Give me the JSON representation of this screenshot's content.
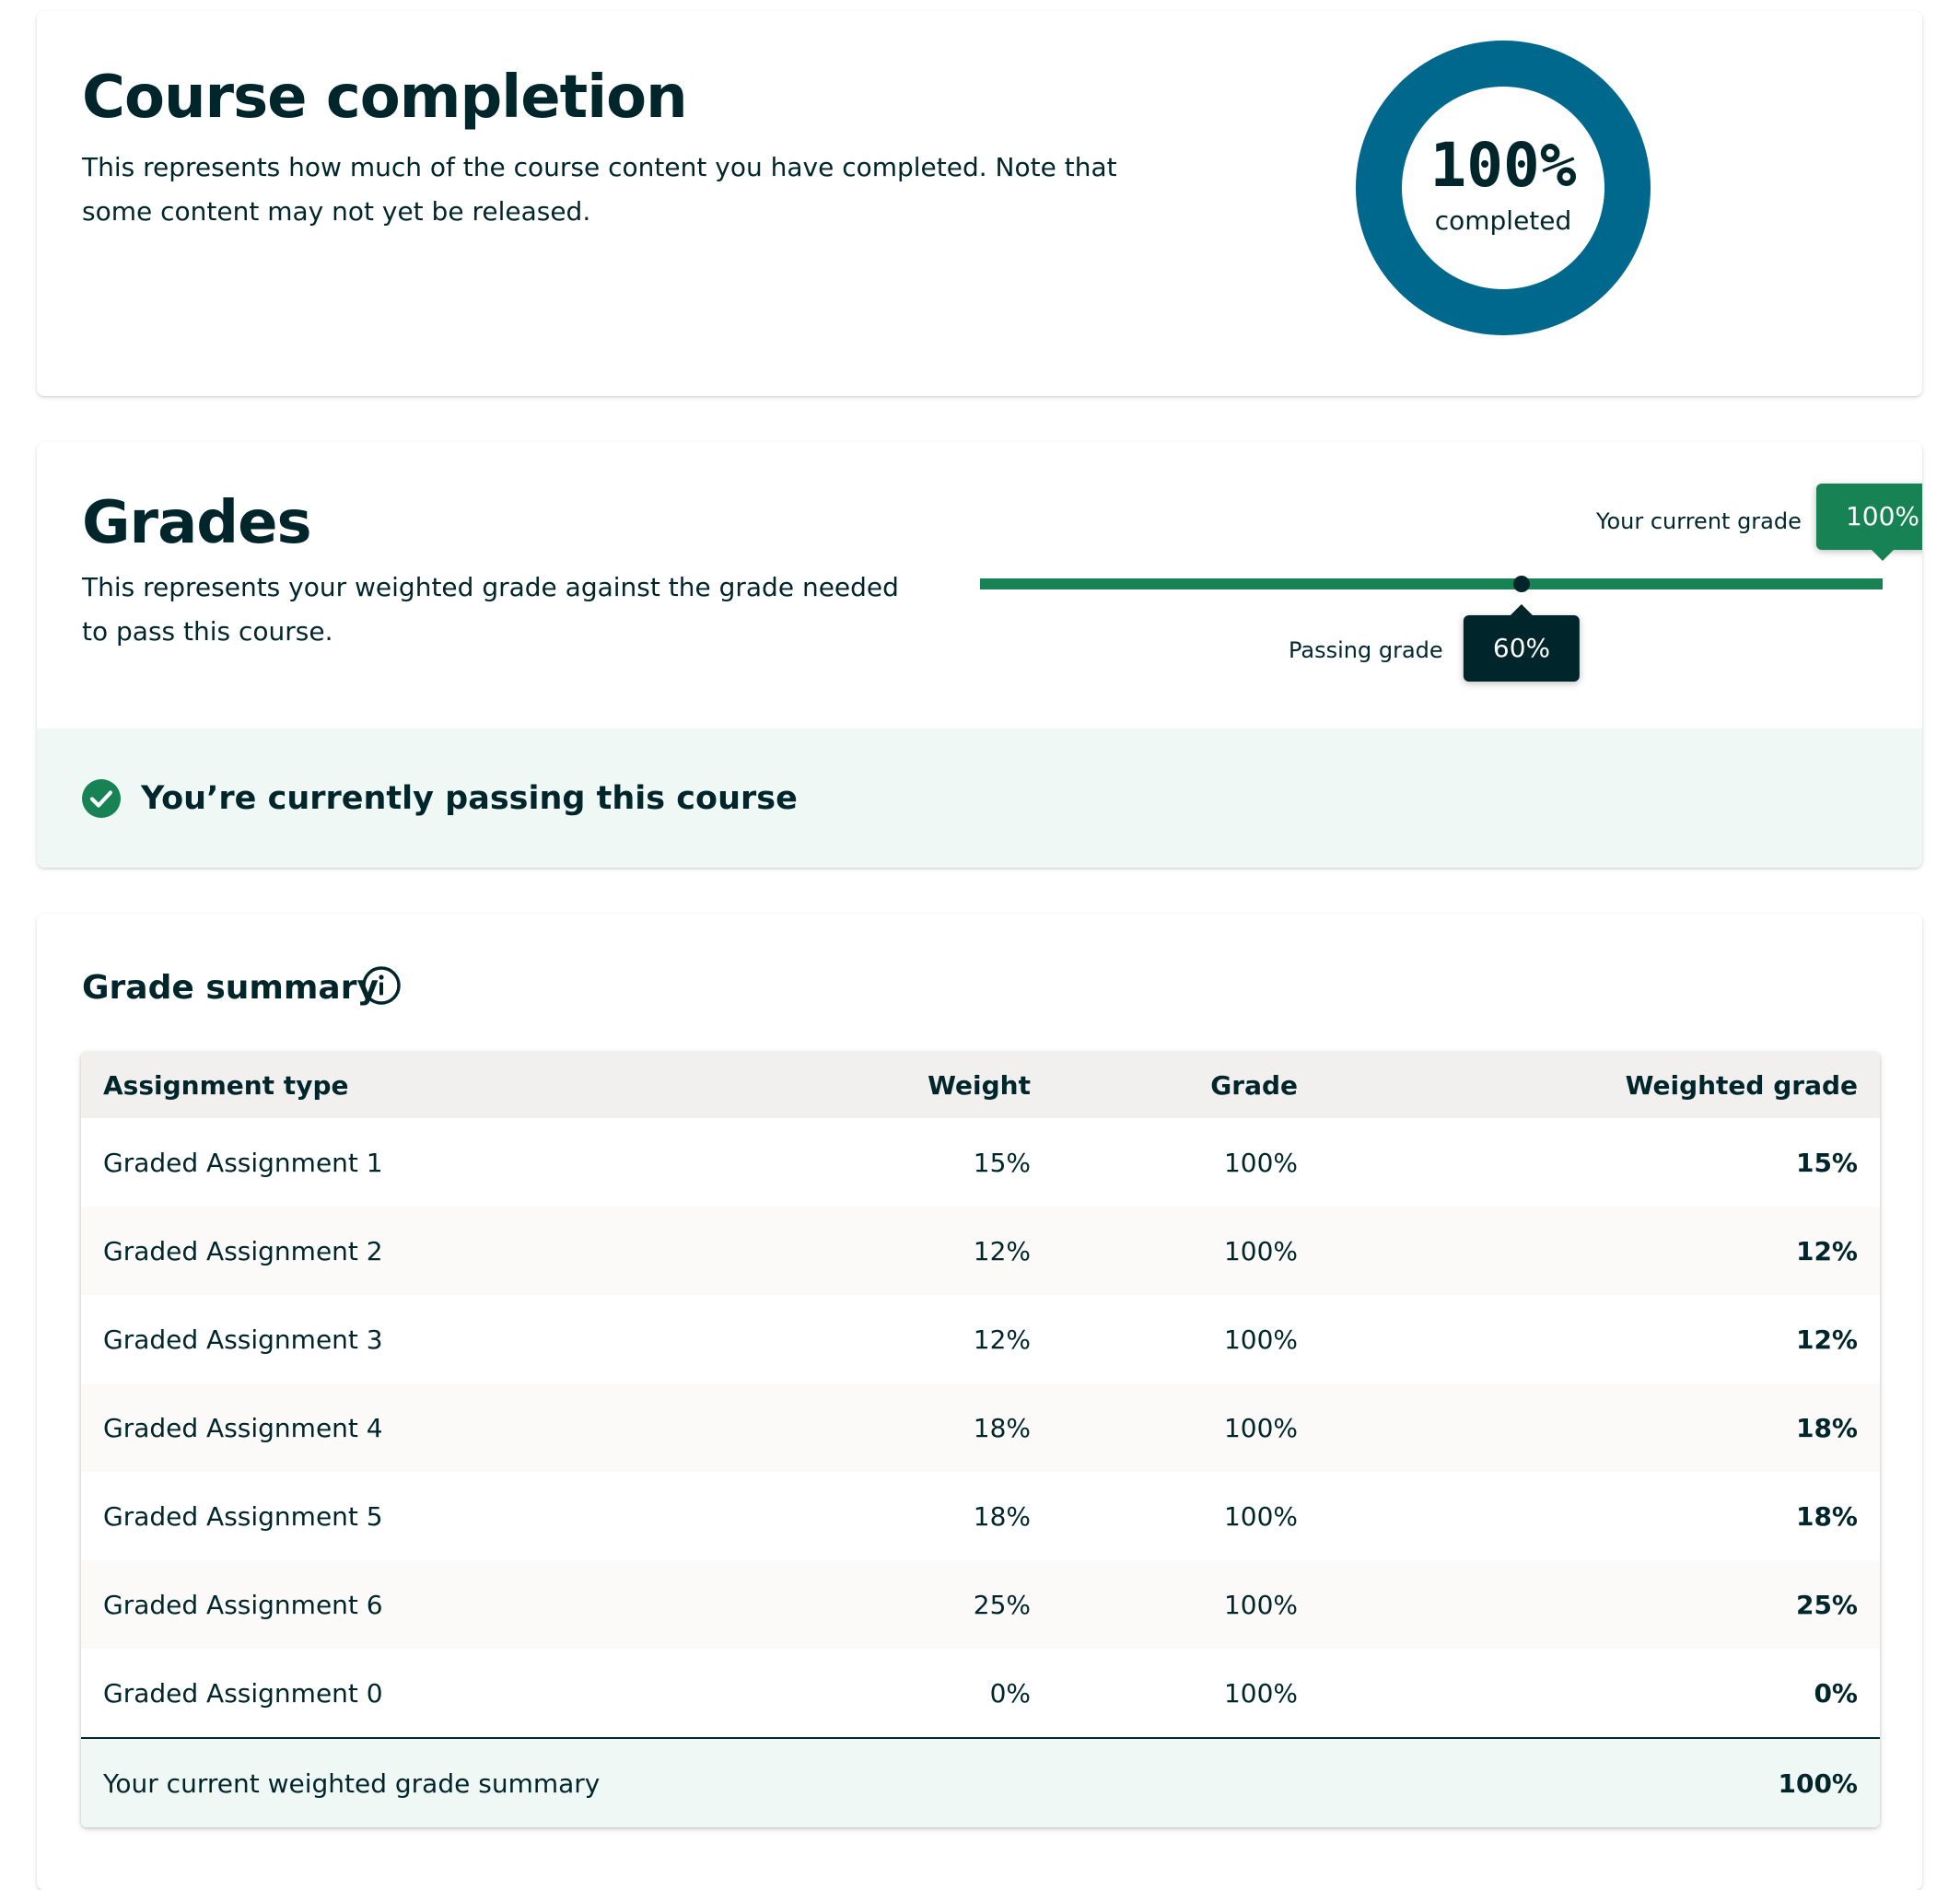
{
  "completion": {
    "title": "Course completion",
    "description": "This represents how much of the course content you have completed. Note that some content may not yet be released.",
    "percent_label": "100%",
    "percent_value": 100,
    "sub_label": "completed",
    "ring_color": "#00688d"
  },
  "grades": {
    "title": "Grades",
    "description": "This represents your weighted grade against the grade needed to pass this course.",
    "current_grade_label": "Your current grade",
    "current_grade_value": "100%",
    "current_grade_fraction": 1.0,
    "passing_grade_label": "Passing grade",
    "passing_grade_value": "60%",
    "passing_grade_fraction": 0.6,
    "bar_color": "#178253",
    "status_text": "You’re currently passing this course",
    "status_color": "#178253"
  },
  "summary": {
    "title": "Grade summary",
    "headers": {
      "type": "Assignment type",
      "weight": "Weight",
      "grade": "Grade",
      "weighted": "Weighted grade"
    },
    "rows": [
      {
        "type": "Graded Assignment 1",
        "weight": "15%",
        "grade": "100%",
        "weighted": "15%"
      },
      {
        "type": "Graded Assignment 2",
        "weight": "12%",
        "grade": "100%",
        "weighted": "12%"
      },
      {
        "type": "Graded Assignment 3",
        "weight": "12%",
        "grade": "100%",
        "weighted": "12%"
      },
      {
        "type": "Graded Assignment 4",
        "weight": "18%",
        "grade": "100%",
        "weighted": "18%"
      },
      {
        "type": "Graded Assignment 5",
        "weight": "18%",
        "grade": "100%",
        "weighted": "18%"
      },
      {
        "type": "Graded Assignment 6",
        "weight": "25%",
        "grade": "100%",
        "weighted": "25%"
      },
      {
        "type": "Graded Assignment 0",
        "weight": "0%",
        "grade": "100%",
        "weighted": "0%"
      }
    ],
    "footer_label": "Your current weighted grade summary",
    "footer_total": "100%"
  }
}
